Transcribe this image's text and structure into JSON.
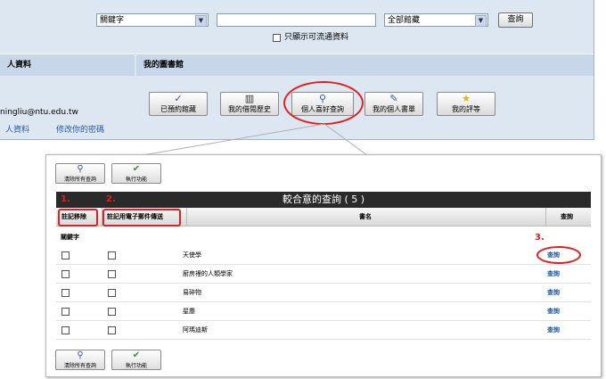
{
  "search": {
    "field_select": "關鍵字",
    "query_value": "",
    "library_select": "全部館藏",
    "search_button": "查詢",
    "available_only_label": "只顯示可流通資料"
  },
  "sections": {
    "personal_info": "人資料",
    "my_library": "我的圖書館"
  },
  "user": {
    "email": "ningliu@ntu.edu.tw",
    "info_link": "人資料",
    "change_password_link": "修改你的密碼"
  },
  "library_buttons": [
    {
      "label": "已預約館藏",
      "icon": "check-icon"
    },
    {
      "label": "我的借閱歷史",
      "icon": "books-icon"
    },
    {
      "label": "個人喜好查詢",
      "icon": "search-icon"
    },
    {
      "label": "我的個人書單",
      "icon": "notepad-icon"
    },
    {
      "label": "我的評等",
      "icon": "star-icon"
    }
  ],
  "saved_searches": {
    "clear_all_button": "清除所有查詢",
    "execute_button": "執行功能",
    "title": "較合意的查詢 ( 5 )",
    "columns": {
      "remove": "註記移除",
      "email": "註記用電子郵件傳送",
      "title": "書名",
      "search": "查詢"
    },
    "group_label": "關鍵字",
    "rows": [
      {
        "title": "天使學",
        "action": "查詢"
      },
      {
        "title": "廚房裡的人類學家",
        "action": "查詢"
      },
      {
        "title": "易碎物",
        "action": "查詢"
      },
      {
        "title": "星塵",
        "action": "查詢"
      },
      {
        "title": "阿瑪迪斯",
        "action": "查詢"
      }
    ]
  },
  "annotations": {
    "step1": "1.",
    "step2": "2.",
    "step3": "3."
  },
  "colors": {
    "highlight": "#e02020",
    "link": "#1b5aa8",
    "panel_bg": "#dde7f1",
    "title_bar": "#2a2a2a"
  }
}
